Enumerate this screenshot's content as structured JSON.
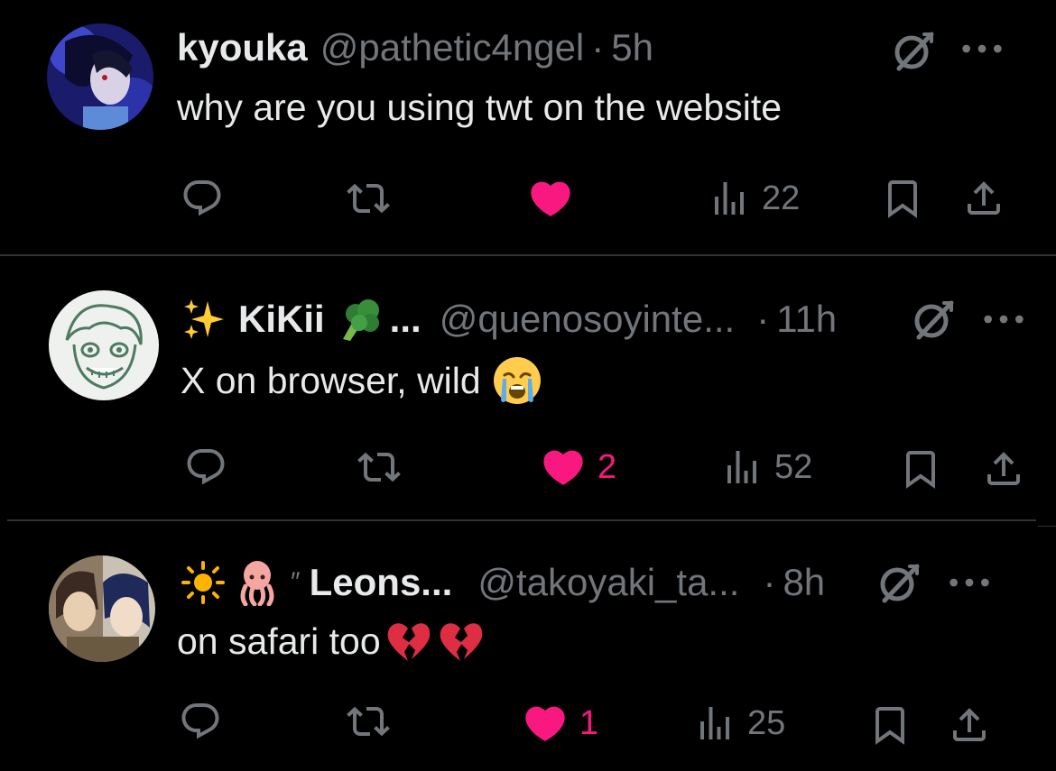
{
  "colors": {
    "background": "#000000",
    "text": "#e7e9ea",
    "secondary": "#71767b",
    "like": "#f91880",
    "divider": "#2f3336"
  },
  "posts": [
    {
      "name": "kyouka",
      "handle": "@pathetic4ngel",
      "separator": "·",
      "time": "5h",
      "text": "why are you using twt on the website",
      "liked": true,
      "likes": "",
      "views": "22",
      "icons": [
        "reply-icon",
        "retweet-icon",
        "like-icon",
        "views-icon",
        "bookmark-icon",
        "share-icon",
        "grok-icon",
        "more-icon"
      ]
    },
    {
      "name": "KiKii",
      "name_suffix": "...",
      "handle": "@quenosoyinte...",
      "separator": "·",
      "time": "11h",
      "text": "X on browser, wild",
      "liked": true,
      "likes": "2",
      "views": "52",
      "icons": [
        "sparkles-emoji",
        "broccoli-emoji",
        "crying-face-emoji"
      ]
    },
    {
      "name_prefix": "″",
      "name": "Leons...",
      "handle": "@takoyaki_ta...",
      "separator": "·",
      "time": "8h",
      "text": "on safari too",
      "liked": true,
      "likes": "1",
      "views": "25",
      "icons": [
        "sun-emoji",
        "squid-emoji",
        "broken-heart-emoji"
      ]
    }
  ]
}
